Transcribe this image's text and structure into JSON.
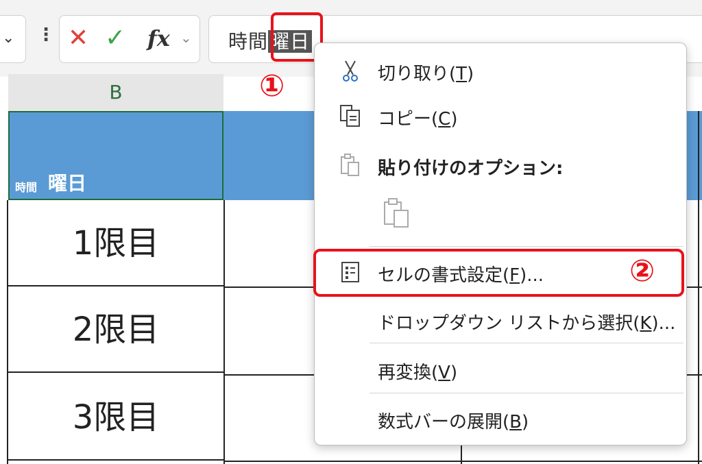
{
  "formula_bar": {
    "namebox_chevron": "⌄",
    "more_icon": "⋮",
    "cancel_icon": "✕",
    "enter_icon": "✓",
    "fx_label": "fx",
    "fx_chevron": "⌄",
    "text_before": "時間",
    "text_selected": "曜日"
  },
  "markers": {
    "one": "①",
    "two": "②"
  },
  "grid": {
    "column_header": "B",
    "header_cell_small": "時間",
    "header_cell_large": "曜日",
    "rows": [
      "1限目",
      "2限目",
      "3限目"
    ]
  },
  "context_menu": {
    "items": [
      {
        "icon": "scissors-icon",
        "label": "切り取り(",
        "key": "T",
        "suffix": ")"
      },
      {
        "icon": "copy-icon",
        "label": "コピー(",
        "key": "C",
        "suffix": ")"
      },
      {
        "icon": "paste-icon",
        "label": "貼り付けのオプション:",
        "key": "",
        "suffix": ""
      },
      {
        "icon": "format-cells-icon",
        "label": "セルの書式設定(",
        "key": "F",
        "suffix": ")..."
      },
      {
        "icon": "",
        "label": "ドロップダウン リストから選択(",
        "key": "K",
        "suffix": ")..."
      },
      {
        "icon": "",
        "label": "再変換(",
        "key": "V",
        "suffix": ")"
      },
      {
        "icon": "",
        "label": "数式バーの展開(",
        "key": "B",
        "suffix": ")"
      }
    ]
  },
  "colors": {
    "header_fill": "#5b9bd5",
    "highlight_red": "#e8121a",
    "column_header_text": "#2d6e3f"
  }
}
